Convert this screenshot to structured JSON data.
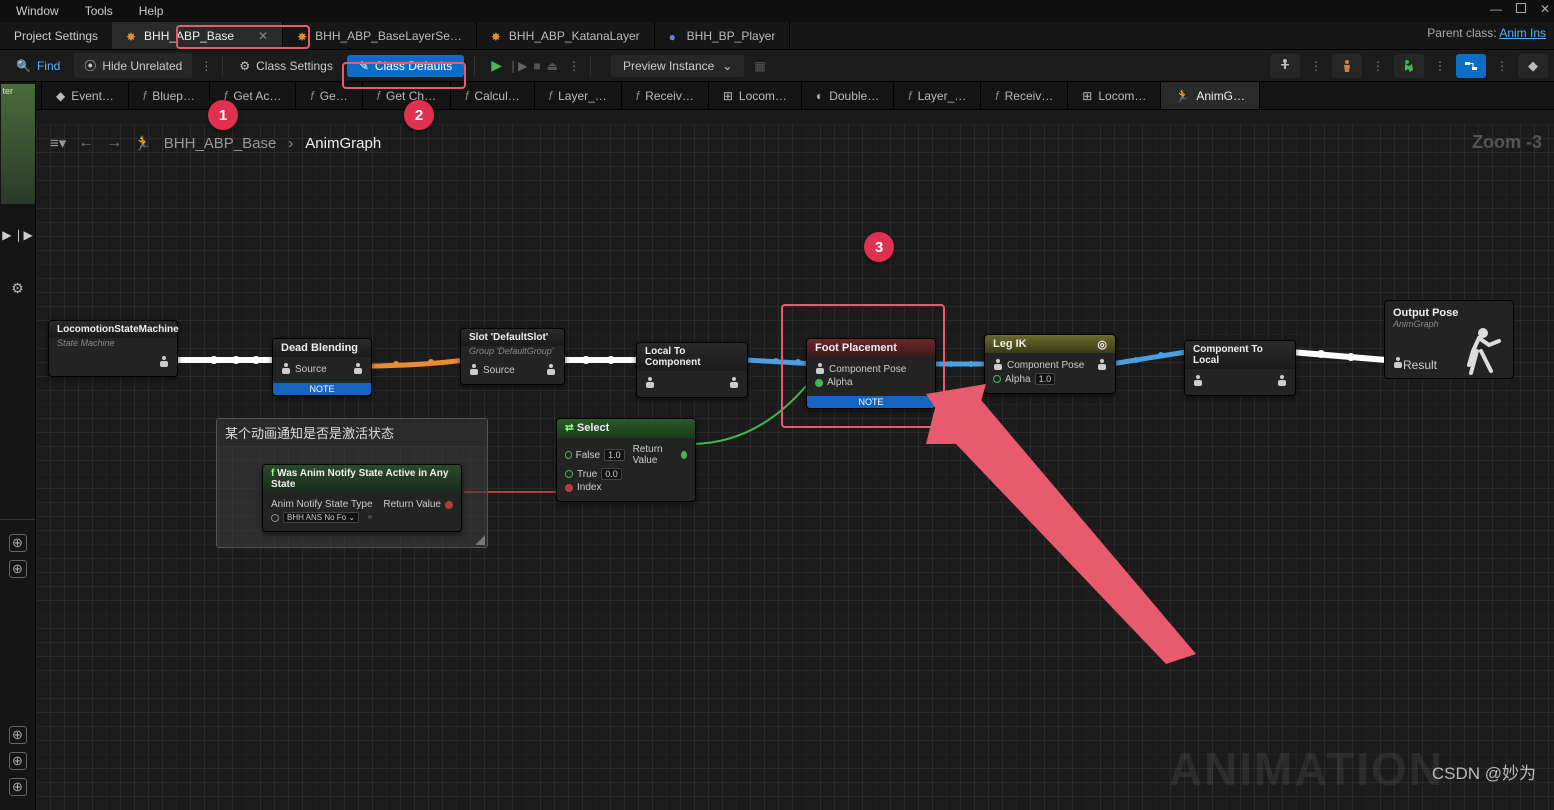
{
  "menu": {
    "window": "Window",
    "tools": "Tools",
    "help": "Help"
  },
  "tabs": {
    "project": "Project Settings",
    "t1": "BHH_ABP_Base",
    "t2": "BHH_ABP_BaseLayerSe…",
    "t3": "BHH_ABP_KatanaLayer",
    "t4": "BHH_BP_Player"
  },
  "parent": {
    "label": "Parent class:",
    "value": "Anim Ins"
  },
  "toolbar": {
    "find": "Find",
    "hide": "Hide Unrelated",
    "settings": "Class Settings",
    "defaults": "Class Defaults",
    "preview": "Preview Instance"
  },
  "fntabs": [
    "Event…",
    "Bluep…",
    "Get Ac…",
    "Ge…",
    "Get Ch…",
    "Calcul…",
    "Layer_…",
    "Receiv…",
    "Locom…",
    "Double…",
    "Layer_…",
    "Receiv…",
    "Locom…",
    "AnimG…"
  ],
  "breadcrumb": {
    "root": "BHH_ABP_Base",
    "leaf": "AnimGraph"
  },
  "zoom": "Zoom -3",
  "nodes": {
    "lsm": {
      "title": "LocomotionStateMachine",
      "sub": "State Machine"
    },
    "dead": {
      "title": "Dead Blending",
      "source": "Source",
      "note": "NOTE"
    },
    "slot": {
      "title": "Slot 'DefaultSlot'",
      "sub": "Group 'DefaultGroup'",
      "source": "Source"
    },
    "ltc": {
      "title": "Local To Component"
    },
    "foot": {
      "title": "Foot Placement",
      "cp": "Component Pose",
      "alpha": "Alpha",
      "note": "NOTE"
    },
    "leg": {
      "title": "Leg IK",
      "cp": "Component Pose",
      "alpha": "Alpha",
      "alphav": "1.0"
    },
    "ctl": {
      "title": "Component To Local"
    },
    "out": {
      "title": "Output Pose",
      "sub": "AnimGraph",
      "result": "Result"
    },
    "select": {
      "title": "Select",
      "false": "False",
      "fv": "1.0",
      "true": "True",
      "tv": "0.0",
      "index": "Index",
      "ret": "Return Value"
    },
    "was": {
      "title": "Was Anim Notify State Active in Any State",
      "p1": "Anim Notify State Type",
      "sel": "BHH ANS No Fo",
      "ret": "Return Value"
    },
    "comment": "某个动画通知是否是激活状态"
  },
  "annot": {
    "n1": "1",
    "n2": "2",
    "n3": "3"
  },
  "watermark": "ANIMATION",
  "credit": "CSDN @妙为",
  "leftstrip": {
    "label": "ter"
  }
}
